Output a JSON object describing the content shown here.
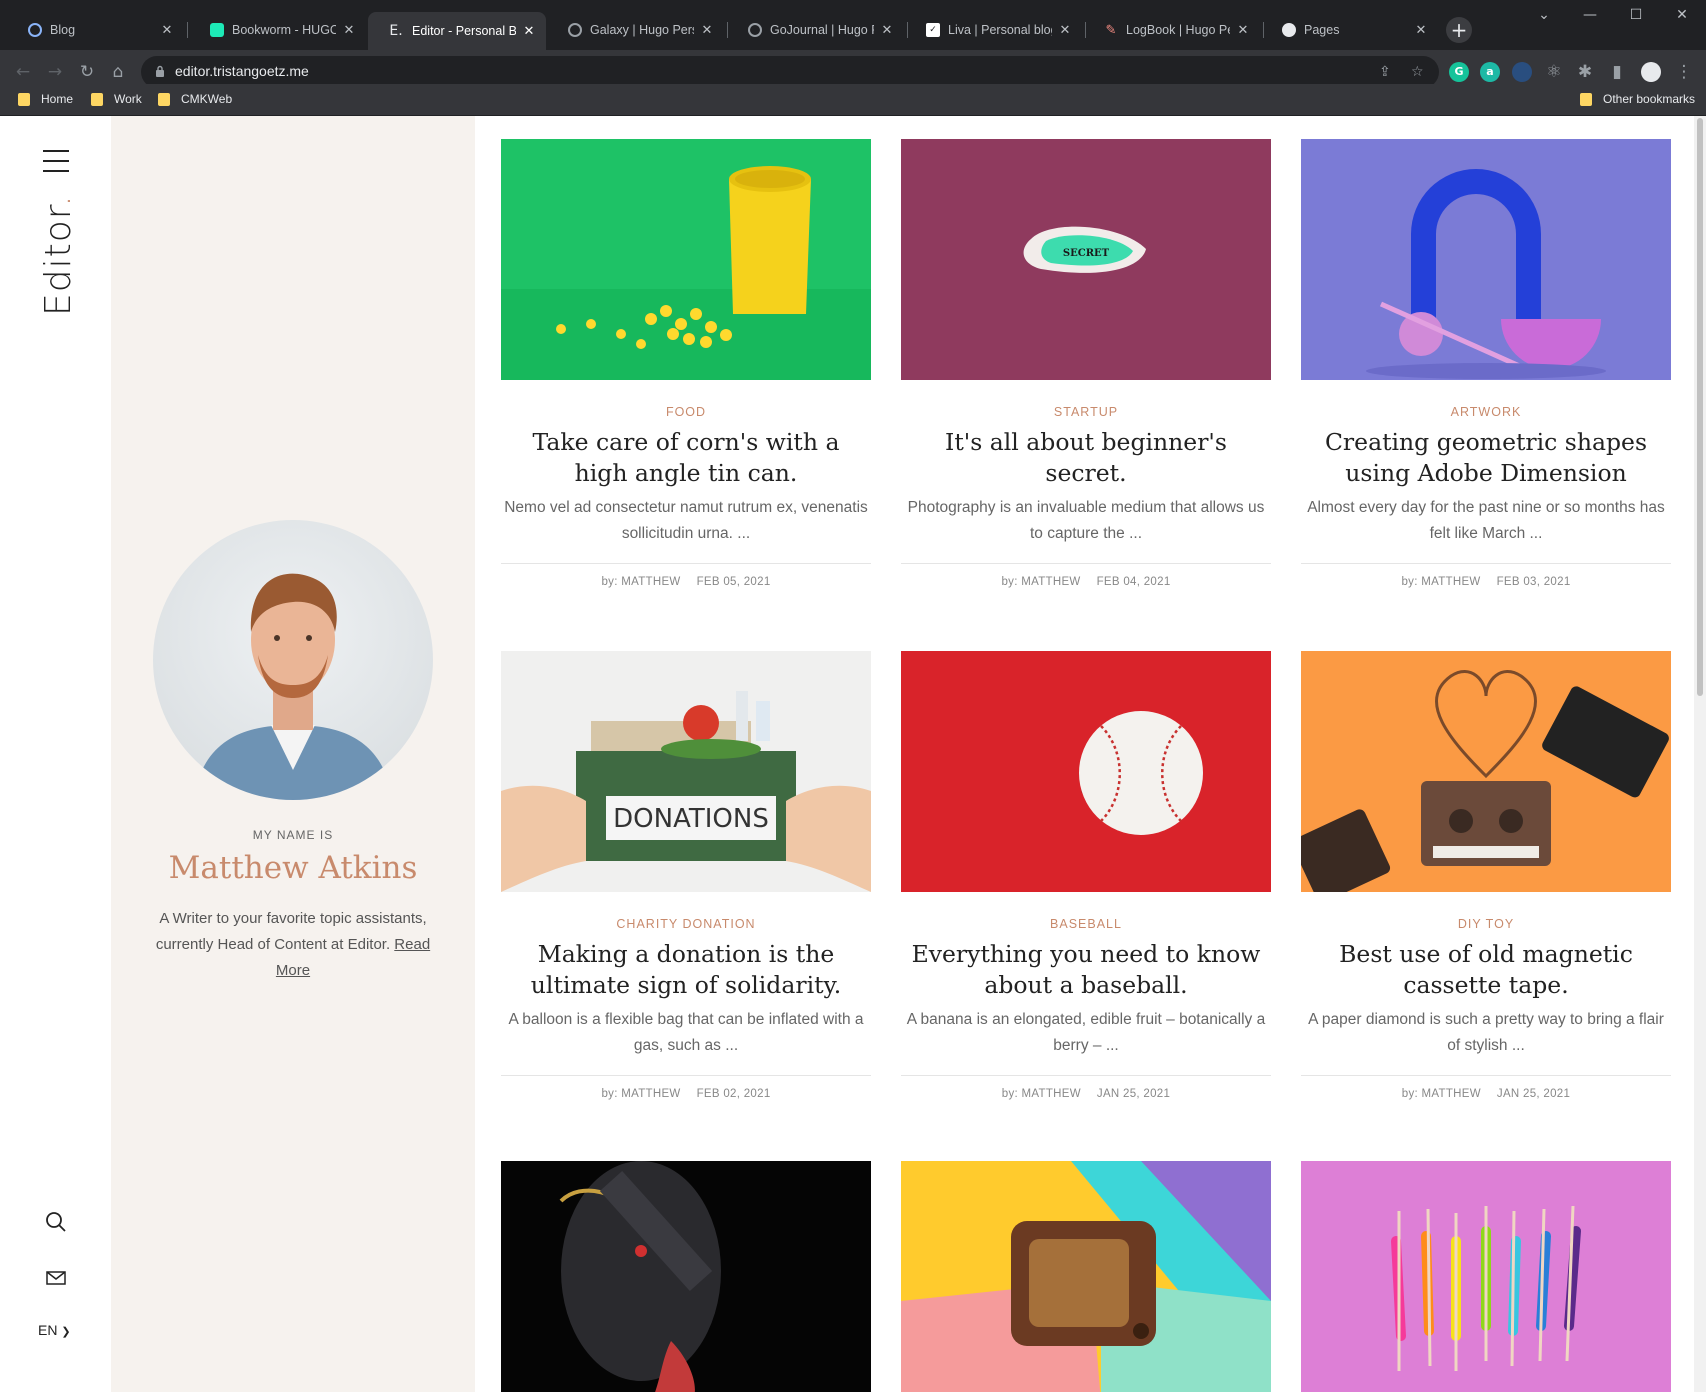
{
  "browser": {
    "tabs": [
      {
        "title": "Blog",
        "icon": "hugo-blog-favicon",
        "color": "#8ab4f8"
      },
      {
        "title": "Bookworm - HUGO Blog",
        "icon": "bookworm-favicon",
        "color": "#1de9b6"
      },
      {
        "title": "Editor - Personal Blog",
        "icon": "editor-favicon",
        "color": "#e8eaed"
      },
      {
        "title": "Galaxy | Hugo Personal",
        "icon": "globe-icon",
        "color": "#9aa0a6"
      },
      {
        "title": "GoJournal | Hugo Personal",
        "icon": "globe-icon",
        "color": "#9aa0a6"
      },
      {
        "title": "Liva | Personal blog template",
        "icon": "liva-favicon",
        "color": "#ffffff"
      },
      {
        "title": "LogBook | Hugo Personal",
        "icon": "pencil-favicon",
        "color": "#f28b82"
      },
      {
        "title": "Pages",
        "icon": "github-icon",
        "color": "#e8eaed"
      }
    ],
    "url": "editor.tristangoetz.me",
    "bookmarks": [
      "Home",
      "Work",
      "CMKWeb"
    ],
    "other_bookmarks": "Other bookmarks"
  },
  "site": {
    "logo": "Editor",
    "logo_dot": ".",
    "accent": "#c88a6c",
    "language": "EN"
  },
  "author": {
    "label": "MY NAME IS",
    "name": "Matthew Atkins",
    "bio": "A Writer to your favorite topic assistants, currently Head of Content at Editor.",
    "read_more": "Read More"
  },
  "posts": [
    {
      "category": "FOOD",
      "title": "Take care of corn's with a high angle tin can.",
      "excerpt": "Nemo vel ad consectetur namut rutrum ex, venenatis sollicitudin urna. ...",
      "author": "by: MATTHEW",
      "date": "FEB 05, 2021",
      "image": "yellow-tin-can-corn",
      "img_label": ""
    },
    {
      "category": "STARTUP",
      "title": "It's all about beginner's secret.",
      "excerpt": "Photography is an invaluable medium that allows us to capture the ...",
      "author": "by: MATTHEW",
      "date": "FEB 04, 2021",
      "image": "torn-paper-secret",
      "img_label": "SECRET"
    },
    {
      "category": "ARTWORK",
      "title": "Creating geometric shapes using Adobe Dimension",
      "excerpt": "Almost every day for the past nine or so months has felt like March ...",
      "author": "by: MATTHEW",
      "date": "FEB 03, 2021",
      "image": "blue-arch-3d-shapes",
      "img_label": ""
    },
    {
      "category": "CHARITY  DONATION",
      "title": "Making a donation is the ultimate sign of solidarity.",
      "excerpt": "A balloon is a flexible bag that can be inflated with a gas, such as ...",
      "author": "by: MATTHEW",
      "date": "FEB 02, 2021",
      "image": "donations-box",
      "img_label": "DONATIONS"
    },
    {
      "category": "BASEBALL",
      "title": "Everything you need to know about a baseball.",
      "excerpt": "A banana is an elongated, edible fruit – botanically a berry – ...",
      "author": "by: MATTHEW",
      "date": "JAN 25, 2021",
      "image": "baseball-red",
      "img_label": ""
    },
    {
      "category": "DIY  TOY",
      "title": "Best use of old magnetic cassette tape.",
      "excerpt": "A paper diamond is such a pretty way to bring a flair of stylish ...",
      "author": "by: MATTHEW",
      "date": "JAN 25, 2021",
      "image": "cassette-heart",
      "img_label": ""
    },
    {
      "image": "painted-face"
    },
    {
      "image": "vintage-radio"
    },
    {
      "image": "candy-sticks"
    }
  ]
}
